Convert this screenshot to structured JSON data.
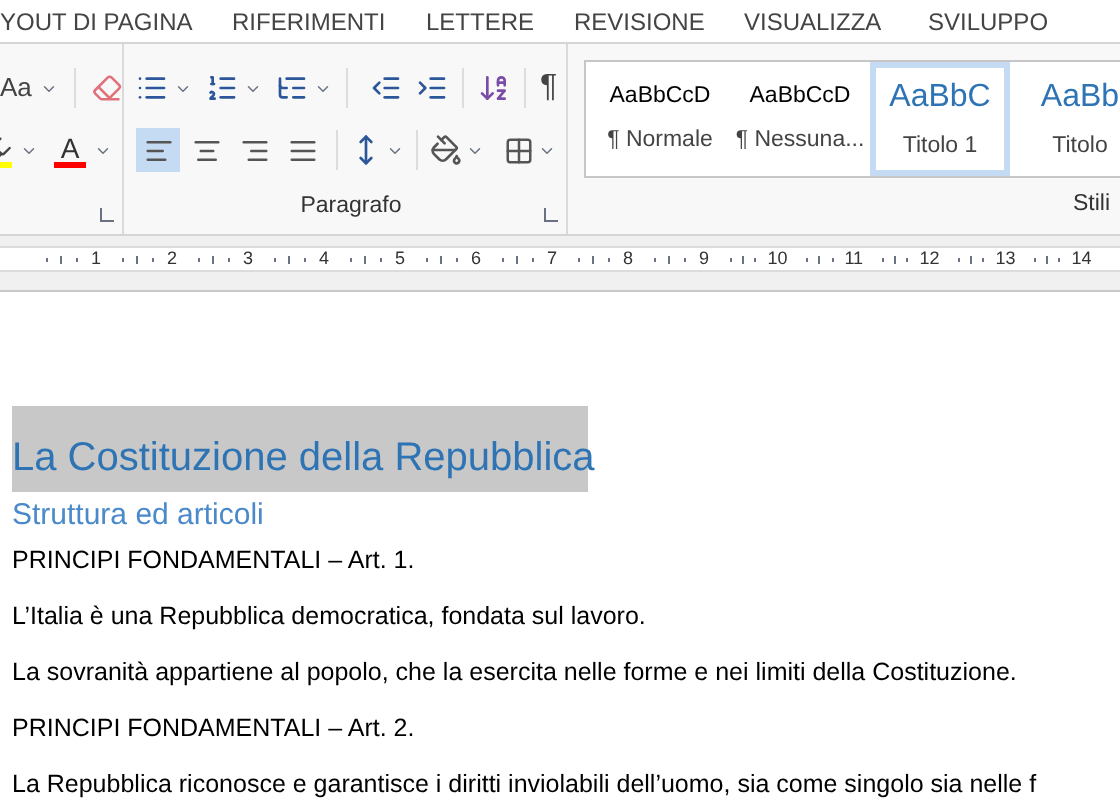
{
  "tabs": [
    {
      "label": "YOUT DI PAGINA"
    },
    {
      "label": "RIFERIMENTI"
    },
    {
      "label": "LETTERE"
    },
    {
      "label": "REVISIONE"
    },
    {
      "label": "VISUALIZZA"
    },
    {
      "label": "SVILUPPO"
    }
  ],
  "font_group": {
    "change_case": "Aa",
    "font_color": "A"
  },
  "paragraph_group": {
    "label": "Paragrafo",
    "pilcrow": "¶",
    "alignment": [
      {
        "selected": true
      },
      {
        "selected": false
      },
      {
        "selected": false
      },
      {
        "selected": false
      }
    ]
  },
  "styles_group": {
    "label": "Stili",
    "items": [
      {
        "preview": "AaBbCcD",
        "name": "¶ Normale",
        "kind": "body",
        "selected": false
      },
      {
        "preview": "AaBbCcD",
        "name": "¶ Nessuna...",
        "kind": "body",
        "selected": false
      },
      {
        "preview": "AaBbC",
        "name": "Titolo 1",
        "kind": "heading",
        "selected": true
      },
      {
        "preview": "AaBb",
        "name": "Titolo",
        "kind": "heading",
        "selected": false
      }
    ]
  },
  "ruler": [
    "1",
    "2",
    "3",
    "4",
    "5",
    "6",
    "7",
    "8",
    "9",
    "10",
    "11",
    "12",
    "13",
    "14"
  ],
  "document": {
    "title": {
      "text": "La Costituzione della Repubblica",
      "highlighted": true
    },
    "subtitle": "Struttura ed articoli",
    "paragraphs": [
      "PRINCIPI FONDAMENTALI – Art. 1.",
      "L’Italia è una Repubblica democratica, fondata sul lavoro.",
      "La sovranità appartiene al popolo, che la esercita nelle forme e nei limiti della Costituzione.",
      "PRINCIPI FONDAMENTALI – Art. 2.",
      "La Repubblica riconosce e garantisce i diritti inviolabili dell’uomo, sia come singolo sia nelle f"
    ]
  }
}
